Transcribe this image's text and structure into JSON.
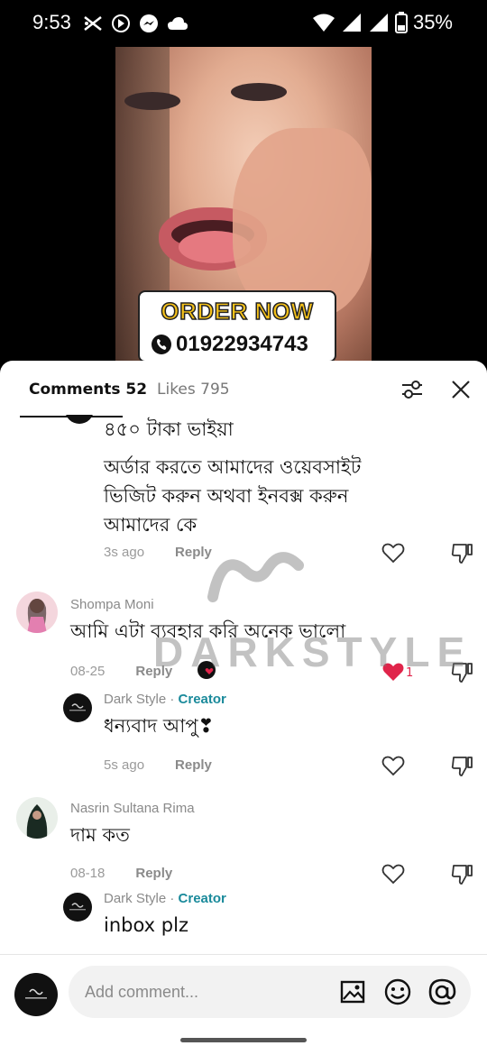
{
  "status_bar": {
    "time": "9:53",
    "battery": "35%"
  },
  "video": {
    "order_text": "ORDER NOW",
    "phone": "01922934743"
  },
  "header": {
    "comments_tab": "Comments 52",
    "likes_tab": "Likes 795"
  },
  "comments": [
    {
      "id": "c0",
      "text_lines": [
        "৪৫০ টাকা ভাইয়া",
        "অর্ডার করতে আমাদের ওয়েবসাইট",
        "ভিজিট করুন অথবা ইনবক্স করুন",
        "আমাদের কে"
      ],
      "time": "3s ago",
      "reply": "Reply"
    },
    {
      "id": "c1",
      "author": "Shompa Moni",
      "text": "আমি এটা ব্যবহার করি অনেক ভালো",
      "time": "08-25",
      "reply": "Reply",
      "likes": "1"
    },
    {
      "id": "c2",
      "author": "Dark Style",
      "creator_label": "Creator",
      "text": "ধন্যবাদ আপু❣",
      "time": "5s ago",
      "reply": "Reply"
    },
    {
      "id": "c3",
      "author": "Nasrin Sultana Rima",
      "text": "দাম কত",
      "time": "08-18",
      "reply": "Reply"
    },
    {
      "id": "c4",
      "author": "Dark Style",
      "creator_label": "Creator",
      "text": "inbox plz"
    }
  ],
  "watermark": "DARKSTYLE",
  "composer": {
    "placeholder": "Add comment..."
  },
  "colors": {
    "creator": "#1a8a9b",
    "like_active": "#e0244a"
  }
}
